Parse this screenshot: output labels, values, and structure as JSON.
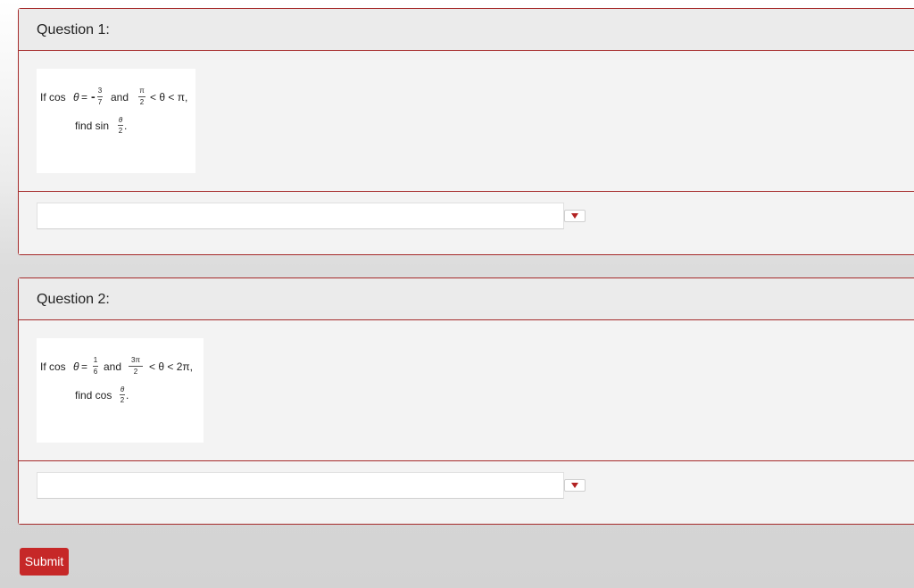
{
  "questions": [
    {
      "label": "Question 1:",
      "problem": {
        "line1": {
          "prefix": "If cos",
          "theta": "θ",
          "eq": "=",
          "sign": "-",
          "frac_num": "3",
          "frac_den": "7",
          "and": "and",
          "bound_num": "π",
          "bound_den": "2",
          "tail": "< θ < π,"
        },
        "line2": {
          "prefix": "find sin",
          "frac_num": "θ",
          "frac_den": "2",
          "end": "."
        }
      },
      "answer": {
        "value": ""
      }
    },
    {
      "label": "Question 2:",
      "problem": {
        "line1": {
          "prefix": "If cos",
          "theta": "θ",
          "eq": "=",
          "frac_num": "1",
          "frac_den": "6",
          "and": "and",
          "bound_num": "3π",
          "bound_den": "2",
          "tail": "< θ < 2π,"
        },
        "line2": {
          "prefix": "find cos",
          "frac_num": "θ",
          "frac_den": "2",
          "end": "."
        }
      },
      "answer": {
        "value": ""
      }
    }
  ],
  "submit_label": "Submit",
  "colors": {
    "accent": "#c62828",
    "border": "#a52a2a",
    "panel": "#f3f3f3",
    "header": "#ebebeb"
  },
  "icons": {
    "dropdown": "dropdown-arrow-icon"
  }
}
